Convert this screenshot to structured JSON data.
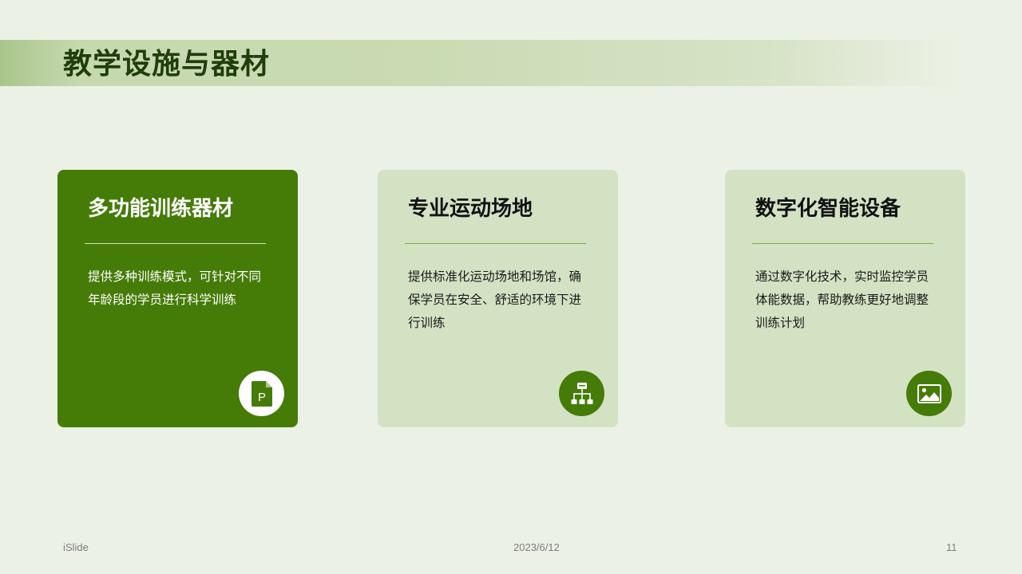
{
  "header": {
    "title": "教学设施与器材"
  },
  "cards": [
    {
      "title": "多功能训练器材",
      "description": "提供多种训练模式，可针对不同年龄段的学员进行科学训练",
      "icon": "document-p-icon"
    },
    {
      "title": "专业运动场地",
      "description": "提供标准化运动场地和场馆，确保学员在安全、舒适的环境下进行训练",
      "icon": "sitemap-icon"
    },
    {
      "title": "数字化智能设备",
      "description": "通过数字化技术，实时监控学员体能数据，帮助教练更好地调整训练计划",
      "icon": "image-icon"
    }
  ],
  "footer": {
    "brand": "iSlide",
    "date": "2023/6/12",
    "page_number": "11"
  },
  "colors": {
    "primary_green": "#457b07",
    "light_card": "#d3e2c3",
    "background": "#ecf1e5",
    "title_text": "#213d0a"
  }
}
